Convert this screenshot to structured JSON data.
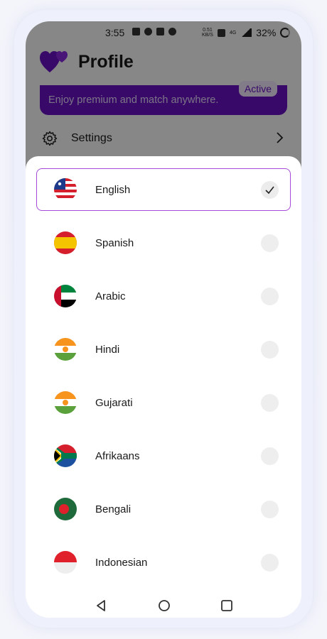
{
  "status_bar": {
    "time": "3:55",
    "network_speed": "0.51\nKB/S",
    "network_type": "4G",
    "battery": "32%"
  },
  "header": {
    "title": "Profile"
  },
  "promo": {
    "text": "Enjoy  premium and match anywhere.",
    "badge": "Active"
  },
  "settings": {
    "label": "Settings"
  },
  "languages": [
    {
      "label": "English",
      "flag": "us-flag-icon",
      "selected": true
    },
    {
      "label": "Spanish",
      "flag": "spain-flag-icon",
      "selected": false
    },
    {
      "label": "Arabic",
      "flag": "uae-flag-icon",
      "selected": false
    },
    {
      "label": "Hindi",
      "flag": "india-flag-icon",
      "selected": false
    },
    {
      "label": "Gujarati",
      "flag": "india-flag-icon",
      "selected": false
    },
    {
      "label": "Afrikaans",
      "flag": "south-africa-flag-icon",
      "selected": false
    },
    {
      "label": "Bengali",
      "flag": "bangladesh-flag-icon",
      "selected": false
    },
    {
      "label": "Indonesian",
      "flag": "indonesia-flag-icon",
      "selected": false
    }
  ],
  "colors": {
    "brand": "#6a12c4",
    "selected_border": "#a44bd9"
  }
}
